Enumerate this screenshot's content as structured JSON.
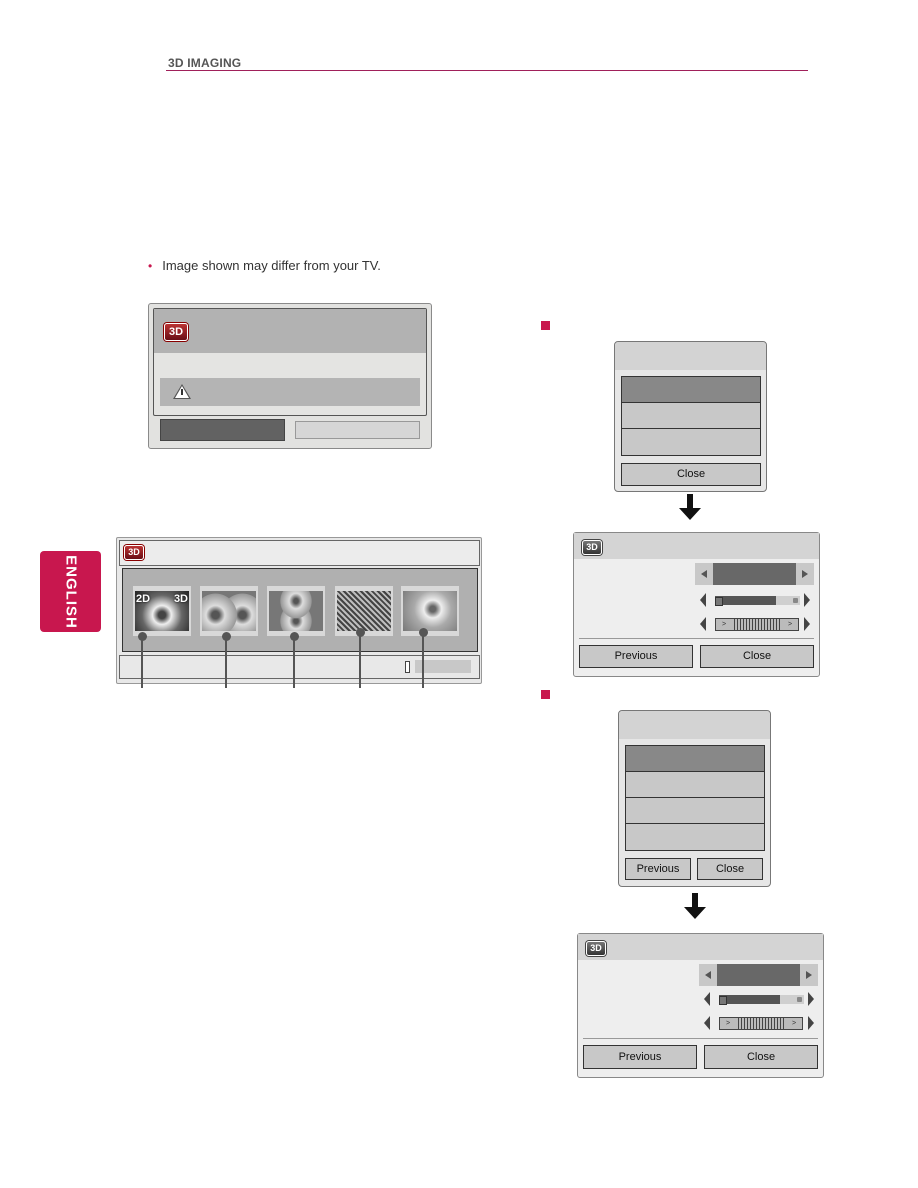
{
  "header": {
    "section_title": "3D IMAGING"
  },
  "note": {
    "bullet": "•",
    "text": "Image shown may differ from your TV."
  },
  "language_tab": {
    "label": "ENGLISH"
  },
  "warning_dialog": {
    "badge": "3D",
    "icon": "warning-icon"
  },
  "mode_dialog": {
    "badge": "3D",
    "thumbnails": [
      {
        "label_left": "2D",
        "label_right": "3D",
        "type": "2d-to-3d"
      },
      {
        "type": "side-by-side"
      },
      {
        "type": "top-and-bottom"
      },
      {
        "type": "checkerboard"
      },
      {
        "type": "single-frame"
      }
    ]
  },
  "menu_dialog_1": {
    "items_count": 3,
    "selected_index": 0,
    "close_label": "Close"
  },
  "settings_dialog_1": {
    "badge": "3D",
    "slider_value": 0.72,
    "previous_label": "Previous",
    "close_label": "Close"
  },
  "menu_dialog_2": {
    "items_count": 4,
    "selected_index": 0,
    "previous_label": "Previous",
    "close_label": "Close"
  },
  "settings_dialog_2": {
    "badge": "3D",
    "slider_value": 0.72,
    "previous_label": "Previous",
    "close_label": "Close"
  },
  "colors": {
    "accent": "#c8174e",
    "rule": "#a0205a"
  }
}
